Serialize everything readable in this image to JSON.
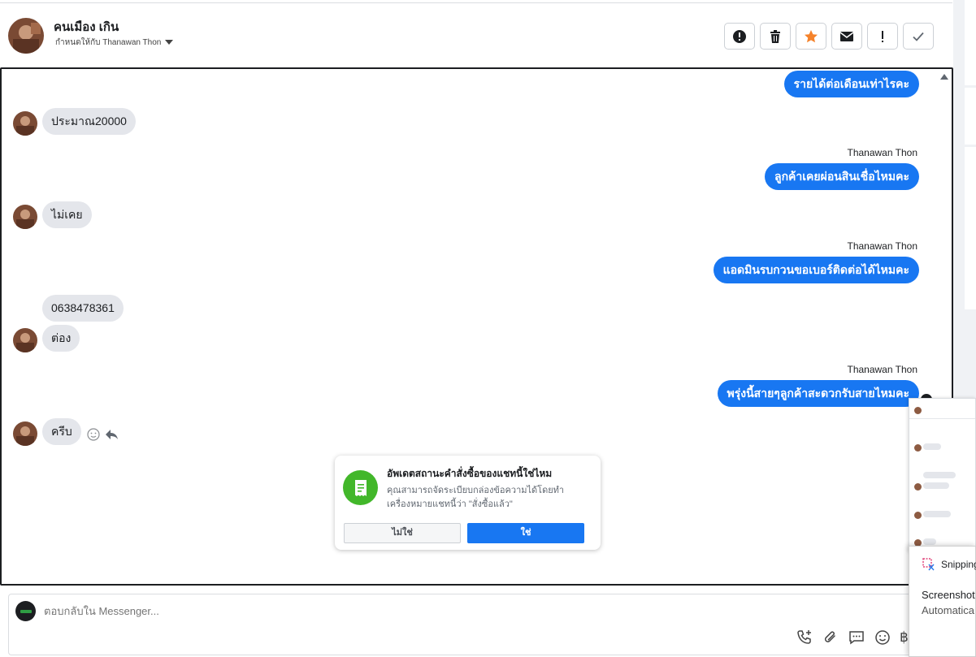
{
  "header": {
    "contact_name": "คนเมือง เกิน",
    "assigned_label": "กำหนดให้กับ Thanawan Thon"
  },
  "toolbar": {
    "icons": [
      "alert-circle-icon",
      "trash-icon",
      "star-icon",
      "envelope-icon",
      "exclamation-icon",
      "check-icon"
    ]
  },
  "messages": [
    {
      "direction": "out",
      "text": "รายได้ต่อเดือนเท่าไรคะ"
    },
    {
      "direction": "in",
      "text": "ประมาณ20000"
    },
    {
      "direction": "out",
      "sender": "Thanawan Thon",
      "text": "ลูกค้าเคยผ่อนสินเชื่อไหมคะ"
    },
    {
      "direction": "in",
      "text": "ไม่เคย"
    },
    {
      "direction": "out",
      "sender": "Thanawan Thon",
      "text": "แอดมินรบกวนขอเบอร์ติดต่อได้ไหมคะ"
    },
    {
      "direction": "in",
      "text": "0638478361"
    },
    {
      "direction": "in",
      "text": "ต่อง"
    },
    {
      "direction": "out",
      "sender": "Thanawan Thon",
      "text": "พรุ่งนี้สายๆลูกค้าสะดวกรับสายไหมคะ"
    },
    {
      "direction": "in",
      "text": "ครีบ"
    }
  ],
  "popup": {
    "title": "อัพเดตสถานะคำสั่งซื้อของแชทนี้ใช่ไหม",
    "description": "คุณสามารถจัดระเบียบกล่องข้อความได้โดยทำเครื่องหมายแชทนี้ว่า \"สั่งซื้อแล้ว\"",
    "no_label": "ไม่ใช่",
    "yes_label": "ใช่",
    "accent_color": "#42b72a"
  },
  "composer": {
    "placeholder": "ตอบกลับใน Messenger...",
    "currency_symbol": "฿"
  },
  "snipping": {
    "app_name": "Snipping",
    "heading": "Screenshot",
    "subtext": "Automatica"
  },
  "colors": {
    "outgoing_bubble": "#1877f2",
    "incoming_bubble": "#e4e6eb"
  }
}
